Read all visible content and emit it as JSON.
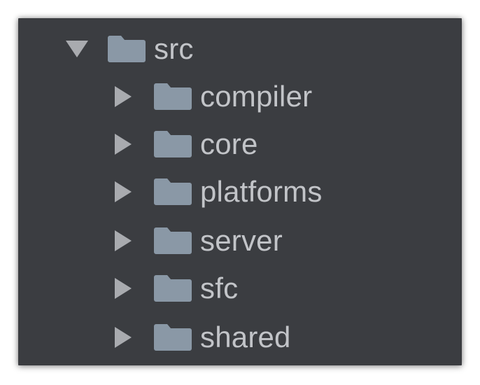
{
  "tree": {
    "root": {
      "label": "src",
      "expanded": true,
      "icon": "folder-icon"
    },
    "children": [
      {
        "label": "compiler",
        "expanded": false,
        "icon": "folder-icon"
      },
      {
        "label": "core",
        "expanded": false,
        "icon": "folder-icon"
      },
      {
        "label": "platforms",
        "expanded": false,
        "icon": "folder-icon"
      },
      {
        "label": "server",
        "expanded": false,
        "icon": "folder-icon"
      },
      {
        "label": "sfc",
        "expanded": false,
        "icon": "folder-icon"
      },
      {
        "label": "shared",
        "expanded": false,
        "icon": "folder-icon"
      }
    ]
  },
  "colors": {
    "panel_background": "#3b3d41",
    "text": "#c2c4c8",
    "folder": "#8a98a6",
    "chevron": "#a9abaf"
  }
}
